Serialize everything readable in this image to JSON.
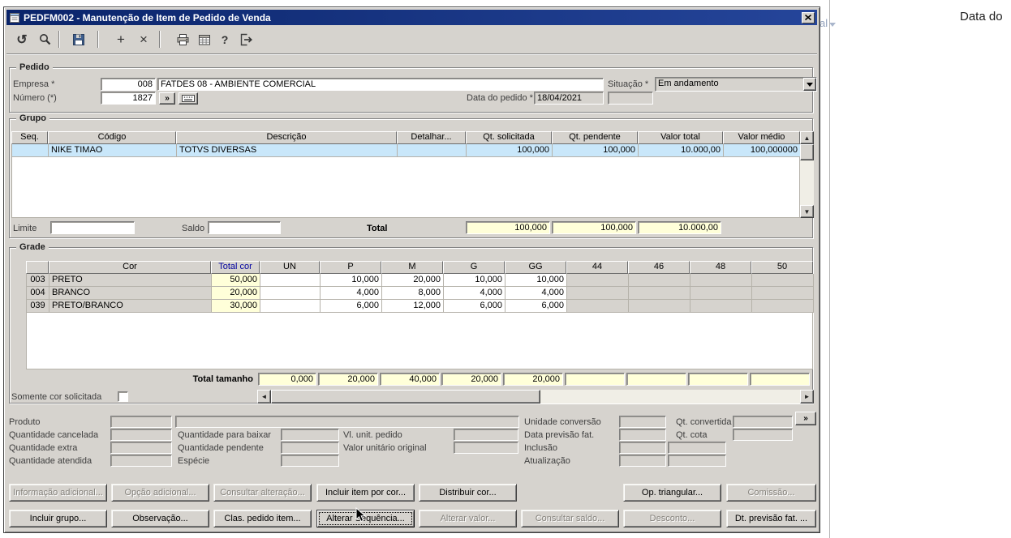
{
  "window": {
    "title": "PEDFM002 - Manutenção de Item de Pedido de Venda"
  },
  "toolbar": {
    "icons": [
      "undo-icon",
      "search-icon",
      "save-icon",
      "add-icon",
      "delete-icon",
      "print-icon",
      "calendar-icon",
      "help-icon",
      "exit-icon"
    ]
  },
  "pedido": {
    "legend": "Pedido",
    "empresa": {
      "label": "Empresa *",
      "code": "008",
      "name": "FATDES 08 - AMBIENTE COMERCIAL"
    },
    "numero": {
      "label": "Número (*)",
      "value": "1827",
      "more_label": "»"
    },
    "data_pedido": {
      "label": "Data do pedido *",
      "value": "18/04/2021"
    },
    "situacao": {
      "label": "Situação *",
      "value": "Em andamento"
    }
  },
  "grupo": {
    "legend": "Grupo",
    "headers": [
      "Seq.",
      "Código",
      "Descrição",
      "Detalhar...",
      "Qt. solicitada",
      "Qt. pendente",
      "Valor total",
      "Valor médio"
    ],
    "row": {
      "seq": "",
      "codigo": "NIKE TIMAO",
      "descricao": "TOTVS DIVERSAS",
      "detalhar": "",
      "qt_solicitada": "100,000",
      "qt_pendente": "100,000",
      "valor_total": "10.000,00",
      "valor_medio": "100,000000"
    },
    "limite_label": "Limite",
    "saldo_label": "Saldo",
    "total_label": "Total",
    "totals": {
      "qt_solicitada": "100,000",
      "qt_pendente": "100,000",
      "valor_total": "10.000,00"
    }
  },
  "grade": {
    "legend": "Grade",
    "headers": [
      "",
      "Cor",
      "Total cor",
      "UN",
      "P",
      "M",
      "G",
      "GG",
      "44",
      "46",
      "48",
      "50"
    ],
    "rows": [
      {
        "code": "003",
        "cor": "PRETO",
        "total": "50,000",
        "un": "",
        "p": "10,000",
        "m": "20,000",
        "g": "10,000",
        "gg": "10,000",
        "c44": "",
        "c46": "",
        "c48": "",
        "c50": ""
      },
      {
        "code": "004",
        "cor": "BRANCO",
        "total": "20,000",
        "un": "",
        "p": "4,000",
        "m": "8,000",
        "g": "4,000",
        "gg": "4,000",
        "c44": "",
        "c46": "",
        "c48": "",
        "c50": ""
      },
      {
        "code": "039",
        "cor": "PRETO/BRANCO",
        "total": "30,000",
        "un": "",
        "p": "6,000",
        "m": "12,000",
        "g": "6,000",
        "gg": "6,000",
        "c44": "",
        "c46": "",
        "c48": "",
        "c50": ""
      }
    ],
    "total_label": "Total tamanho",
    "totals": {
      "un": "0,000",
      "p": "20,000",
      "m": "40,000",
      "g": "20,000",
      "gg": "20,000",
      "c44": "",
      "c46": "",
      "c48": "",
      "c50": ""
    },
    "checkbox_label": "Somente cor solicitada"
  },
  "details": {
    "produto_label": "Produto",
    "qtd_cancelada_label": "Quantidade cancelada",
    "qtd_extra_label": "Quantidade extra",
    "qtd_atendida_label": "Quantidade atendida",
    "qtd_para_baixar_label": "Quantidade para baixar",
    "qtd_pendente_label": "Quantidade pendente",
    "especie_label": "Espécie",
    "vl_unit_pedido_label": "Vl. unit. pedido",
    "valor_unitario_original_label": "Valor unitário original",
    "unidade_conversao_label": "Unidade conversão",
    "data_previsao_label": "Data previsão fat.",
    "inclusao_label": "Inclusão",
    "atualizacao_label": "Atualização",
    "qt_convertida_label": "Qt. convertida",
    "qt_cota_label": "Qt. cota",
    "more_label": "»"
  },
  "buttons_row1": [
    {
      "label": "Informação adicional...",
      "enabled": false
    },
    {
      "label": "Opção adicional...",
      "enabled": false
    },
    {
      "label": "Consultar alteração...",
      "enabled": false
    },
    {
      "label": "Incluir item por cor...",
      "enabled": true
    },
    {
      "label": "Distribuir cor...",
      "enabled": true
    },
    {
      "label": "Op. triangular...",
      "enabled": true
    },
    {
      "label": "Comissão...",
      "enabled": false
    }
  ],
  "buttons_row2": [
    {
      "label": "Incluir grupo...",
      "enabled": true
    },
    {
      "label": "Observação...",
      "enabled": true
    },
    {
      "label": "Clas. pedido item...",
      "enabled": true
    },
    {
      "label": "Alterar Sequência...",
      "enabled": true,
      "focused": true
    },
    {
      "label": "Alterar valor...",
      "enabled": false
    },
    {
      "label": "Consultar saldo...",
      "enabled": false
    },
    {
      "label": "Desconto...",
      "enabled": false
    },
    {
      "label": "Dt. previsão fat. ...",
      "enabled": true
    }
  ],
  "background": {
    "right_header": "Data do",
    "partial_text": "al"
  },
  "colors": {
    "titlebar_blue": "#0a246a",
    "dialog_face": "#d6d3ce",
    "selected_row_blue": "#c9e7fa",
    "totals_yellow": "#ffffd9"
  }
}
